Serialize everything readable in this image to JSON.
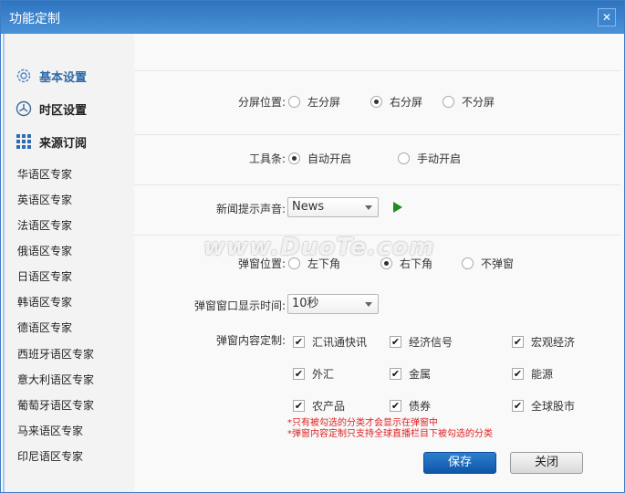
{
  "window": {
    "title": "功能定制",
    "close_label": "✕"
  },
  "sidebar": {
    "sections": [
      {
        "label": "基本设置",
        "icon": "gear-icon",
        "active": true
      },
      {
        "label": "时区设置",
        "icon": "clock-icon",
        "active": false
      },
      {
        "label": "来源订阅",
        "icon": "grid-icon",
        "active": false
      }
    ],
    "items": [
      "华语区专家",
      "英语区专家",
      "法语区专家",
      "俄语区专家",
      "日语区专家",
      "韩语区专家",
      "德语区专家",
      "西班牙语区专家",
      "意大利语区专家",
      "葡萄牙语区专家",
      "马来语区专家",
      "印尼语区专家"
    ]
  },
  "settings": {
    "split": {
      "label": "分屏位置:",
      "options": [
        "左分屏",
        "右分屏",
        "不分屏"
      ],
      "selected": 1
    },
    "toolbar": {
      "label": "工具条:",
      "options": [
        "自动开启",
        "手动开启"
      ],
      "selected": 0
    },
    "sound": {
      "label": "新闻提示声音:",
      "value": "News"
    },
    "popup_position": {
      "label": "弹窗位置:",
      "options": [
        "左下角",
        "右下角",
        "不弹窗"
      ],
      "selected": 1
    },
    "popup_time": {
      "label": "弹窗窗口显示时间:",
      "value": "10秒"
    },
    "popup_content": {
      "label": "弹窗内容定制:",
      "items": [
        {
          "label": "汇讯通快讯",
          "checked": true
        },
        {
          "label": "经济信号",
          "checked": true
        },
        {
          "label": "宏观经济",
          "checked": true
        },
        {
          "label": "外汇",
          "checked": true
        },
        {
          "label": "金属",
          "checked": true
        },
        {
          "label": "能源",
          "checked": true
        },
        {
          "label": "农产品",
          "checked": true
        },
        {
          "label": "债券",
          "checked": true
        },
        {
          "label": "全球股市",
          "checked": true
        }
      ]
    },
    "notes": [
      "*只有被勾选的分类才会显示在弹窗中",
      "*弹窗内容定制只支持全球直播栏目下被勾选的分类"
    ]
  },
  "buttons": {
    "save": "保存",
    "close": "关闭"
  },
  "watermark": "www.DuoTe.com",
  "check_mark": "✔"
}
